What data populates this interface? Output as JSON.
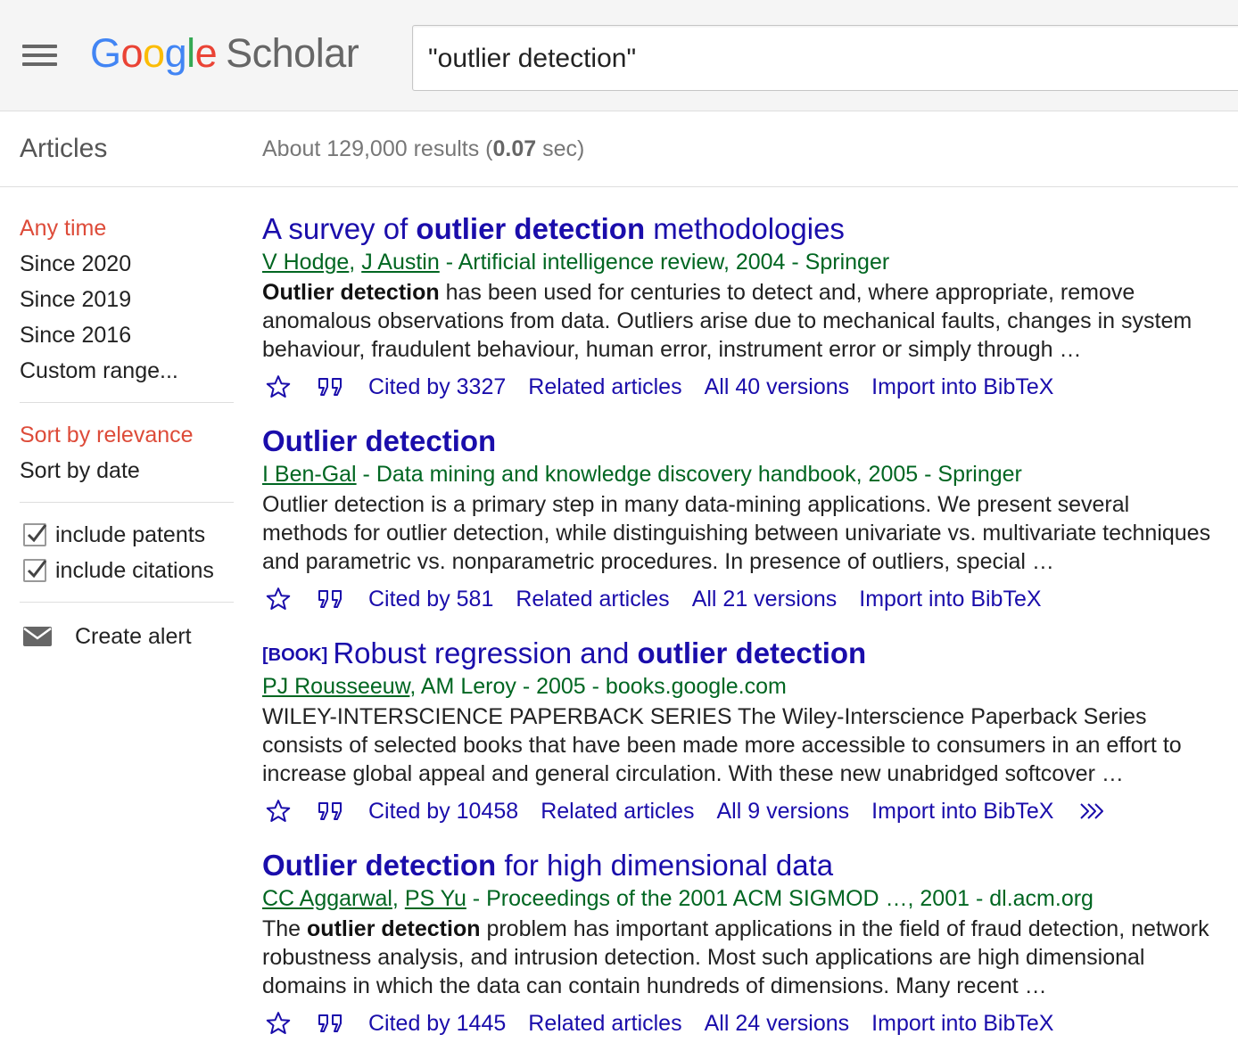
{
  "header": {
    "logo_google": "Google",
    "logo_scholar": "Scholar",
    "search_value": "\"outlier detection\""
  },
  "subheader": {
    "section": "Articles",
    "results_prefix": "About 129,000 results (",
    "results_time": "0.07",
    "results_suffix": " sec)"
  },
  "sidebar": {
    "time_filters": [
      "Any time",
      "Since 2020",
      "Since 2019",
      "Since 2016",
      "Custom range..."
    ],
    "sort_options": [
      "Sort by relevance",
      "Sort by date"
    ],
    "include_patents": "include patents",
    "include_citations": "include citations",
    "create_alert": "Create alert"
  },
  "results": [
    {
      "title_pre": "A survey of ",
      "title_bold": "outlier detection",
      "title_post": " methodologies",
      "author1": "V Hodge",
      "author2": "J Austin",
      "meta_rest": " - Artificial intelligence review, 2004 - Springer",
      "snippet_bold": "Outlier detection",
      "snippet_rest": " has been used for centuries to detect and, where appropriate, remove anomalous observations from data. Outliers arise due to mechanical faults, changes in system behaviour, fraudulent behaviour, human error, instrument error or simply through …",
      "cited": "Cited by 3327",
      "related": "Related articles",
      "versions": "All 40 versions",
      "bibtex": "Import into BibTeX"
    },
    {
      "title_bold": "Outlier detection",
      "author1": "I Ben-Gal",
      "meta_rest": " - Data mining and knowledge discovery handbook, 2005 - Springer",
      "snippet": "Outlier detection is a primary step in many data-mining applications. We present several methods for outlier detection, while distinguishing between univariate vs. multivariate techniques and parametric vs. nonparametric procedures. In presence of outliers, special …",
      "cited": "Cited by 581",
      "related": "Related articles",
      "versions": "All 21 versions",
      "bibtex": "Import into BibTeX"
    },
    {
      "tag": "[BOOK]",
      "title_pre": "Robust regression and ",
      "title_bold": "outlier detection",
      "author1": "PJ Rousseeuw",
      "meta_rest": ", AM Leroy - 2005 - books.google.com",
      "snippet": "WILEY-INTERSCIENCE PAPERBACK SERIES The Wiley-Interscience Paperback Series consists of selected books that have been made more accessible to consumers in an effort to increase global appeal and general circulation. With these new unabridged softcover …",
      "cited": "Cited by 10458",
      "related": "Related articles",
      "versions": "All 9 versions",
      "bibtex": "Import into BibTeX"
    },
    {
      "title_bold": "Outlier detection",
      "title_post": " for high dimensional data",
      "author1": "CC Aggarwal",
      "author2": "PS Yu",
      "meta_rest": " - Proceedings of the 2001 ACM SIGMOD …, 2001 - dl.acm.org",
      "snippet_pre": "The ",
      "snippet_bold": "outlier detection",
      "snippet_rest": " problem has important applications in the field of fraud detection, network robustness analysis, and intrusion detection. Most such applications are high dimensional domains in which the data can contain hundreds of dimensions. Many recent …",
      "cited": "Cited by 1445",
      "related": "Related articles",
      "versions": "All 24 versions",
      "bibtex": "Import into BibTeX"
    }
  ],
  "colors": {
    "link": "#1a0dab",
    "meta_green": "#006621",
    "active_red": "#dd4b39",
    "header_bg": "#f5f5f5"
  }
}
